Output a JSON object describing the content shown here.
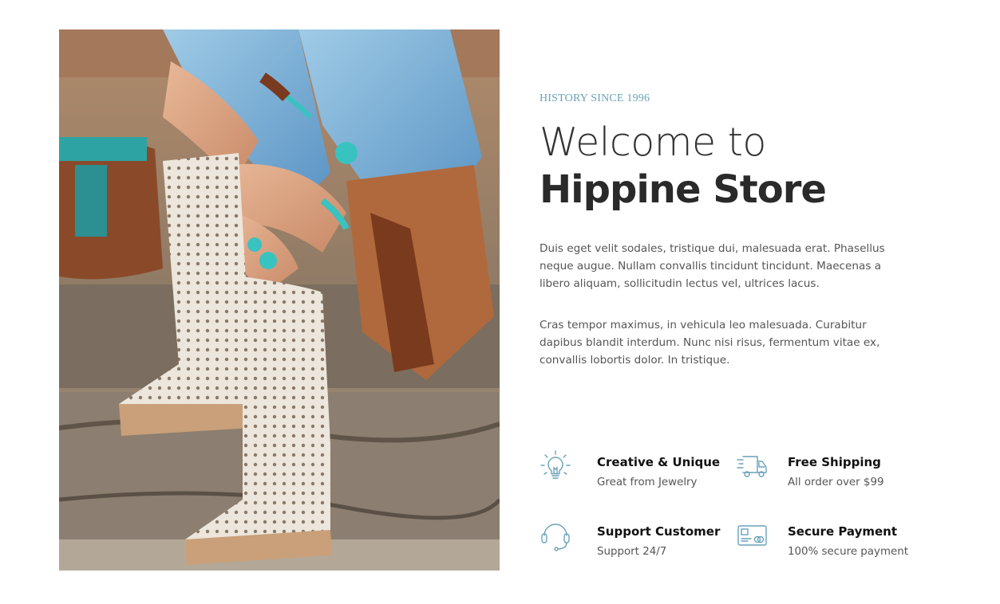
{
  "hero": {
    "image_alt": "Woman wearing white perforated cowboy boots, turquoise rings and bracelets, fringe bag",
    "eyebrow": "HISTORY SINCE 1996",
    "title_light": "Welcome to",
    "title_bold": "Hippine Store",
    "paragraphs": [
      "Duis eget velit sodales, tristique dui, malesuada erat. Phasellus neque augue. Nullam convallis tincidunt tincidunt. Maecenas a libero aliquam, sollicitudin lectus vel, ultrices lacus.",
      "Cras tempor maximus, in vehicula leo malesuada. Curabitur dapibus blandit interdum. Nunc nisi risus, fermentum vitae ex, convallis lobortis dolor. In tristique."
    ]
  },
  "features": [
    {
      "icon": "lightbulb-icon",
      "title": "Creative & Unique",
      "subtitle": "Great from Jewelry"
    },
    {
      "icon": "delivery-truck-icon",
      "title": "Free Shipping",
      "subtitle": "All order over $99"
    },
    {
      "icon": "headset-icon",
      "title": "Support Customer",
      "subtitle": "Support 24/7"
    },
    {
      "icon": "credit-card-icon",
      "title": "Secure Payment",
      "subtitle": "100% secure payment"
    }
  ],
  "colors": {
    "accent": "#6aa2b8",
    "heading": "#2a2a2a",
    "body_text": "#555555",
    "background": "#ffffff"
  }
}
